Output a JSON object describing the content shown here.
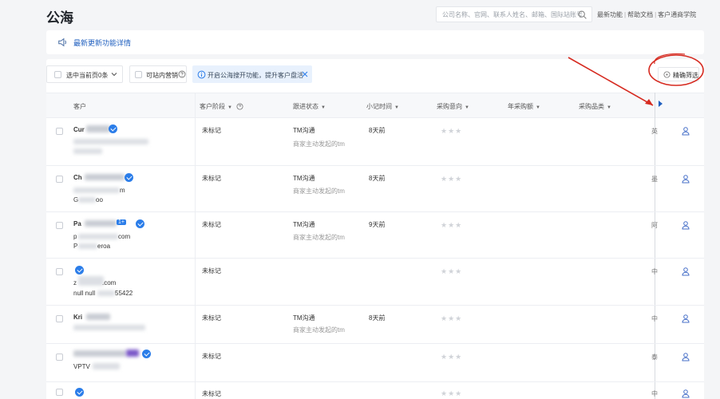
{
  "page": {
    "title": "公海"
  },
  "search": {
    "placeholder": "公司名称、官网、联系人姓名、邮箱、国际站账号"
  },
  "top_links": {
    "new_features": "最新功能",
    "help_docs": "帮助文档",
    "academy": "客户通商学院"
  },
  "notice": {
    "text": "最新更新功能详情"
  },
  "toolbar": {
    "select_page": "选中当前页0条",
    "site_marketing": "可站内营销",
    "open_pool_tip": "开启公海搜开功能，提升客户盘活",
    "precise_filter": "精确筛选"
  },
  "columns": {
    "customer": "客户",
    "stage": "客户阶段",
    "followup": "跟进状态",
    "time": "小记时间",
    "intent": "采购意向",
    "annual": "年采购额",
    "category": "采购品类"
  },
  "rows": [
    {
      "name": "Cur",
      "contact1": "",
      "contact2": "",
      "stage": "未标记",
      "followup": "TM沟通",
      "followup_sub": "商家主动发起的tm",
      "time": "8天前",
      "partial": "英"
    },
    {
      "name": "Ch",
      "contact1": "m",
      "contact2": "G",
      "contact3": "oo",
      "stage": "未标记",
      "followup": "TM沟通",
      "followup_sub": "商家主动发起的tm",
      "time": "8天前",
      "partial": "墨"
    },
    {
      "name": "Pa",
      "badge": "1+",
      "contact1": "p",
      "contact2": "P",
      "contact1_tail": "com",
      "contact2_tail": "eroa",
      "stage": "未标记",
      "followup": "TM沟通",
      "followup_sub": "商家主动发起的tm",
      "time": "9天前",
      "partial": "阿"
    },
    {
      "name": "",
      "contact1": "z",
      "contact1_tail": ".com",
      "contact2": "null null",
      "contact2_tail": "55422",
      "stage": "未标记",
      "followup": "",
      "followup_sub": "",
      "time": "",
      "partial": "中"
    },
    {
      "name": "Kri",
      "contact1": "",
      "contact2": "",
      "stage": "未标记",
      "followup": "TM沟通",
      "followup_sub": "商家主动发起的tm",
      "time": "8天前",
      "partial": "中"
    },
    {
      "name": "",
      "contact1": "VPTV",
      "contact2": "",
      "stage": "未标记",
      "followup": "",
      "followup_sub": "",
      "time": "",
      "partial": "泰"
    },
    {
      "name": "",
      "contact1": "",
      "contact2": "",
      "stage": "未标记",
      "followup": "",
      "followup_sub": "",
      "time": "",
      "partial": "中"
    }
  ],
  "colors": {
    "accent": "#1f5fbf",
    "annotation": "#d62a20"
  }
}
